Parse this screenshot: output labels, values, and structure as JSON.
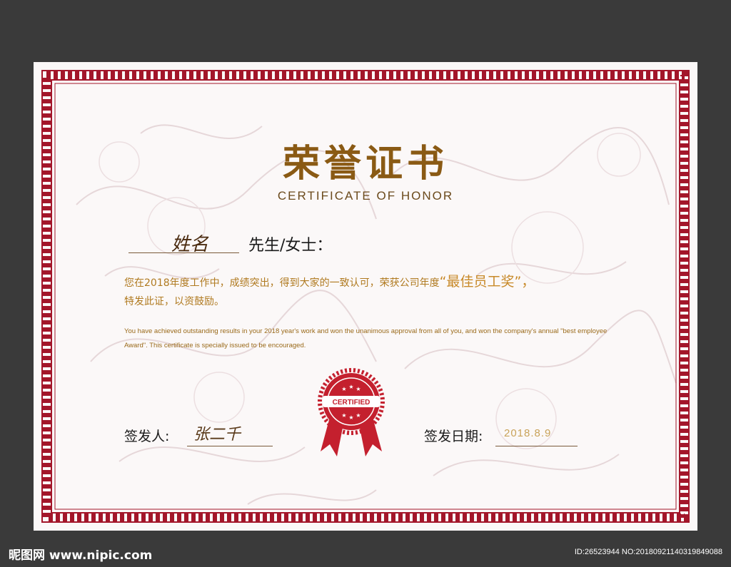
{
  "certificate": {
    "title": "荣誉证书",
    "subtitle": "CERTIFICATE OF HONOR",
    "name_placeholder": "姓名",
    "salutation": "先生/女士：",
    "body_cn_part1": "您在2018年度工作中，成绩突出，得到大家的一致认可，荣获公司年度",
    "award_name": "“最佳员工奖”，",
    "body_cn_part2": "特发此证，以资鼓励。",
    "body_en": "You have achieved outstanding results in your 2018 year's work and won the unanimous approval from all of you, and won the company's annual \"best employee Award\". This certificate is specially issued to be encouraged.",
    "seal_text": "CERTIFIED",
    "signer_label": "签发人:",
    "signer_signature": "张二千",
    "date_label": "签发日期:",
    "date_value": "2018.8.9"
  },
  "footer": {
    "logo": "昵图网 www.nipic.com",
    "id_text": "ID:26523944 NO:20180921140319849088"
  },
  "colors": {
    "background": "#3a3a3a",
    "paper": "#fbf8f8",
    "border_red": "#a3162a",
    "gold": "#8a5a14",
    "seal_red": "#c4202e"
  },
  "icons": {
    "seal": "rosette-ribbon-icon"
  }
}
